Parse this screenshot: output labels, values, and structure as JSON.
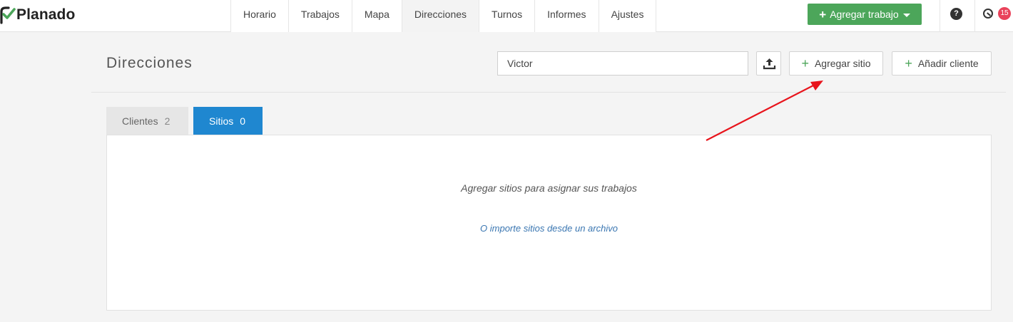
{
  "app": {
    "name": "Planado"
  },
  "nav": {
    "items": [
      {
        "label": "Horario"
      },
      {
        "label": "Trabajos"
      },
      {
        "label": "Mapa"
      },
      {
        "label": "Direcciones",
        "active": true
      },
      {
        "label": "Turnos"
      },
      {
        "label": "Informes"
      },
      {
        "label": "Ajustes"
      }
    ]
  },
  "top_actions": {
    "add_job_label": "Agregar trabajo",
    "help_icon": "question-circle-icon",
    "help_glyph": "?",
    "notifications_icon": "clock-icon",
    "notifications_count": "15"
  },
  "page": {
    "title": "Direcciones",
    "search": {
      "value": "Victor",
      "placeholder": ""
    },
    "upload_icon": "upload-icon",
    "add_site_label": "Agregar sitio",
    "add_client_label": "Añadir cliente"
  },
  "tabs": [
    {
      "label": "Clientes",
      "count": "2",
      "active": false
    },
    {
      "label": "Sitios",
      "count": "0",
      "active": true
    }
  ],
  "panel": {
    "empty_message": "Agregar sitios para asignar sus trabajos",
    "import_link": "O importe sitios desde un archivo"
  },
  "colors": {
    "brand_green": "#4ca65a",
    "tab_active_blue": "#1f87d0",
    "badge_red": "#e9425a",
    "annotation_arrow": "#e8141c",
    "link_blue": "#3a76b1"
  }
}
